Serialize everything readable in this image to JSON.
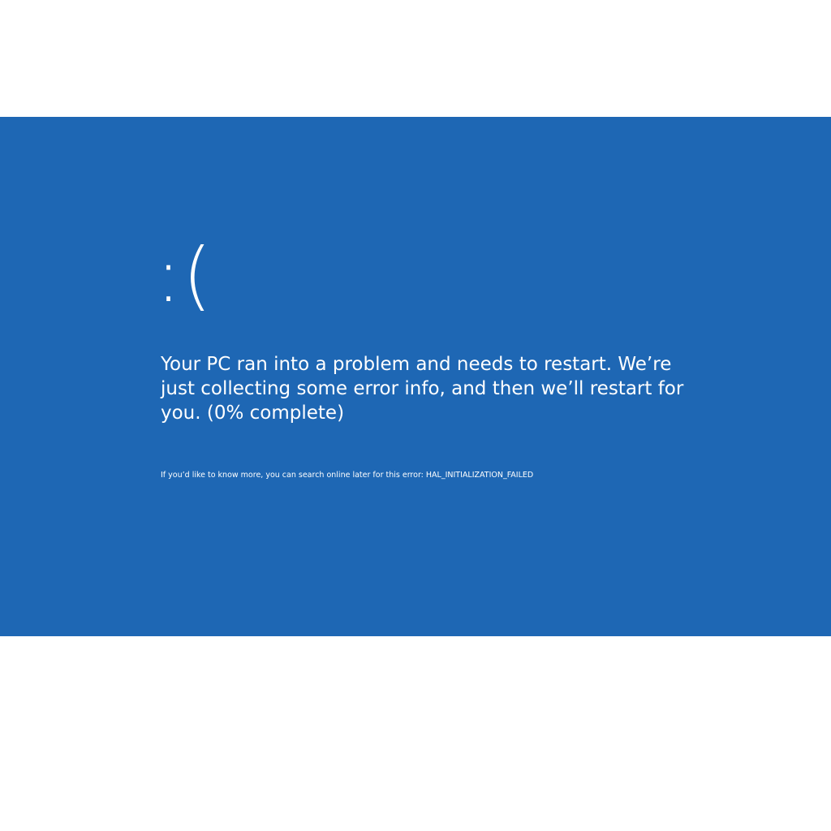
{
  "screen": {
    "background_color": "#1e67b4",
    "text_color": "#ffffff",
    "frame_color": "#ffffff"
  },
  "sad_face": ":(",
  "message": "Your PC ran into a problem and needs to restart. We’re just collecting some error info, and then we’ll restart for you. (0% complete)",
  "info": "If you’d like to know more, you can search online later for this error: HAL_INITIALIZATION_FAILED"
}
